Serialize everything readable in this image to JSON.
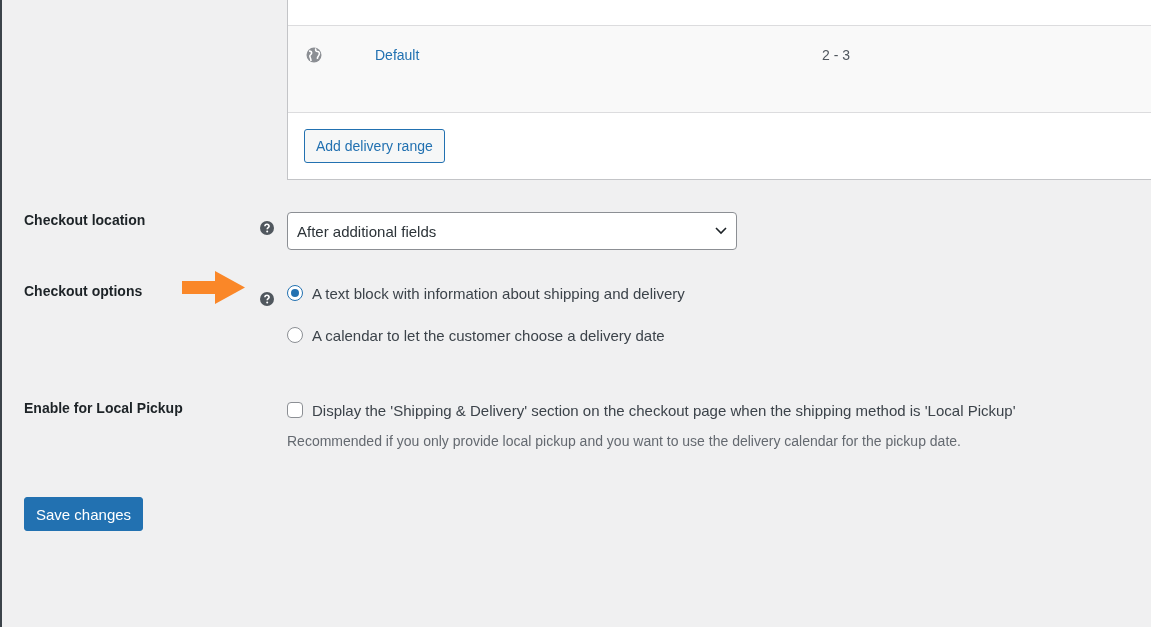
{
  "ranges_table": {
    "rows": [
      {
        "name": "Default",
        "days": "2 - 3"
      }
    ],
    "add_button": "Add delivery range"
  },
  "settings": [
    {
      "kind": "select",
      "label": "Checkout location",
      "help": true,
      "value": "After additional fields"
    },
    {
      "kind": "radio",
      "label": "Checkout options",
      "help": true,
      "highlighted": true,
      "options": [
        {
          "label": "A text block with information about shipping and delivery",
          "selected": true
        },
        {
          "label": "A calendar to let the customer choose a delivery date",
          "selected": false
        }
      ]
    },
    {
      "kind": "checkbox",
      "label": "Enable for Local Pickup",
      "help": false,
      "checkbox": {
        "label": "Display the 'Shipping & Delivery' section on the checkout page when the shipping method is 'Local Pickup'",
        "checked": false
      },
      "description": "Recommended if you only provide local pickup and you want to use the delivery calendar for the pickup date."
    }
  ],
  "save_button": "Save changes"
}
